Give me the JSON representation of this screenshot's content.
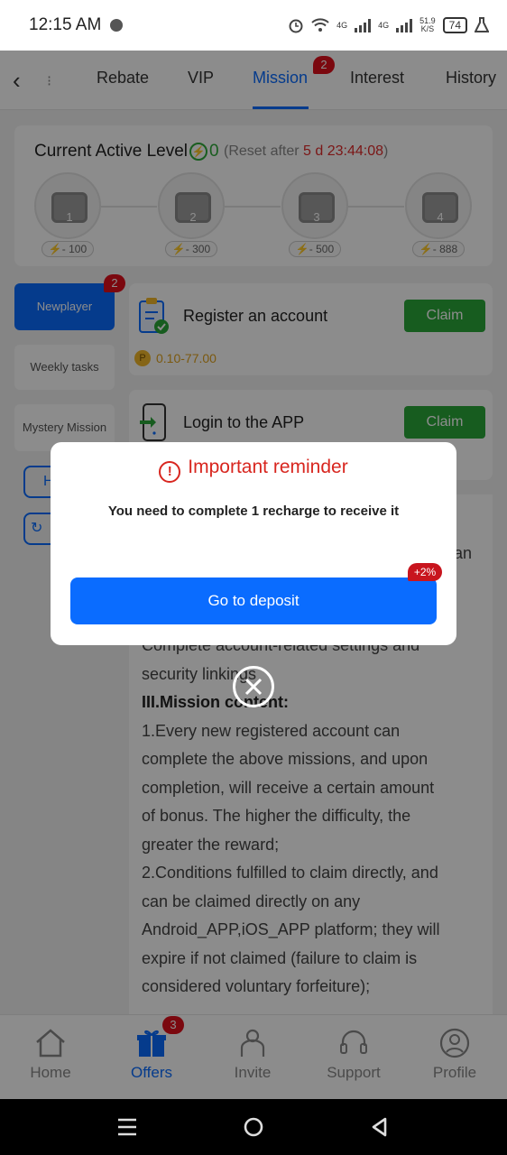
{
  "status": {
    "time": "12:15 AM",
    "net1": "4G",
    "net2": "4G",
    "speed": "51.9",
    "speed_unit": "K/S",
    "battery": "74"
  },
  "tabs": {
    "fragment": "⁝",
    "items": [
      {
        "label": "Rebate"
      },
      {
        "label": "VIP"
      },
      {
        "label": "Mission"
      },
      {
        "label": "Interest"
      },
      {
        "label": "History"
      }
    ],
    "mission_badge": "2"
  },
  "level": {
    "title": "Current Active Level",
    "value": "0",
    "reset_prefix": "(Reset after ",
    "countdown": "5 d 23:44:08",
    "reset_suffix": ")",
    "chests": [
      {
        "num": "1",
        "cost": "- 100"
      },
      {
        "num": "2",
        "cost": "- 300"
      },
      {
        "num": "3",
        "cost": "- 500"
      },
      {
        "num": "4",
        "cost": "- 888"
      }
    ]
  },
  "sidebar": {
    "items": [
      {
        "label": "Newplayer"
      },
      {
        "label": "Weekly tasks"
      },
      {
        "label": "Mystery Mission"
      }
    ],
    "badge": "2",
    "outline1": "H"
  },
  "tasks": [
    {
      "name": "Register an account",
      "claim": "Claim",
      "reward": "0.10-77.00"
    },
    {
      "name": "Login to the APP",
      "claim": "Claim"
    }
  ],
  "rules": {
    "partial_an": "an",
    "lines": [
      "Complete account-related settings and",
      "security linkings"
    ],
    "section": "III.Mission content:",
    "body": [
      "1.Every new registered account can",
      "complete the above missions, and upon",
      "completion, will receive a certain amount",
      "of bonus. The higher the difficulty, the",
      "greater the reward;",
      "2.Conditions fulfilled to claim directly, and",
      "can be claimed directly on any",
      "Android_APP,iOS_APP platform; they will",
      "expire if not claimed (failure to claim is",
      "considered voluntary forfeiture);"
    ]
  },
  "bottomnav": {
    "items": [
      {
        "label": "Home"
      },
      {
        "label": "Offers"
      },
      {
        "label": "Invite"
      },
      {
        "label": "Support"
      },
      {
        "label": "Profile"
      }
    ],
    "offers_badge": "3"
  },
  "modal": {
    "title": "Important reminder",
    "message": "You need to complete 1 recharge to receive it",
    "button": "Go to deposit",
    "tag": "+2%"
  },
  "colors": {
    "accent": "#0a6cff",
    "claim": "#2aa83a",
    "alert": "#d8261f"
  }
}
